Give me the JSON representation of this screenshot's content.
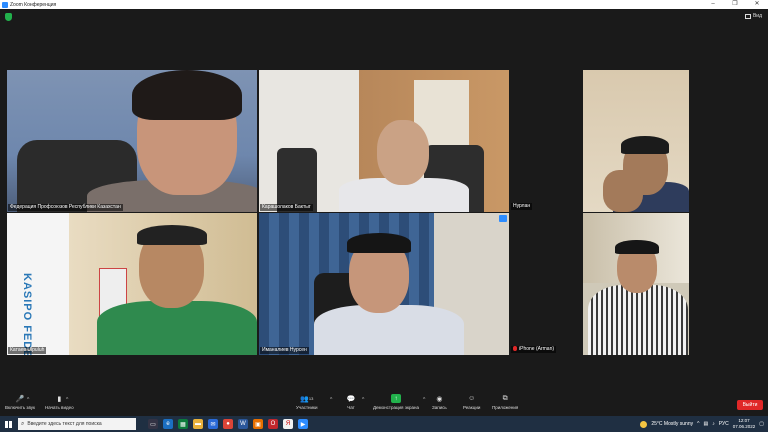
{
  "window": {
    "title": "Zoom Конференция",
    "view_label": "Вид",
    "controls": [
      "–",
      "❐",
      "✕"
    ]
  },
  "participants": [
    {
      "name": "Федерация Профсоюзов Республики Казахстан",
      "active": false,
      "muted": false
    },
    {
      "name": "Карашолаков Бактыг",
      "active": false,
      "muted": false
    },
    {
      "name": "Нурлан",
      "active": false,
      "muted": false
    },
    {
      "name": "Катаев Ulpuluh",
      "active": true,
      "muted": false
    },
    {
      "name": "Иманалиев Нурсен",
      "active": false,
      "muted": false
    },
    {
      "name": "iPhone (Arman)",
      "active": false,
      "muted": true
    }
  ],
  "banner_text": "KASIPO FEDERA",
  "toolbar": {
    "mic_label": "Включить звук",
    "video_label": "Начать видео",
    "participants_label": "Участники",
    "participants_count": "13",
    "chat_label": "Чат",
    "share_label": "Демонстрация экрана",
    "record_label": "Запись",
    "reactions_label": "Реакции",
    "apps_label": "Приложения",
    "leave_label": "Выйти"
  },
  "taskbar": {
    "search_placeholder": "Введите здесь текст для поиска",
    "weather": "25°C  Mostly sunny",
    "lang": "РУС",
    "time": "12:07",
    "date": "07.06.2022"
  },
  "colors": {
    "active_speaker": "#b8e634",
    "leave": "#e02828",
    "share": "#22b14c",
    "zoom_blue": "#2d8cff"
  }
}
